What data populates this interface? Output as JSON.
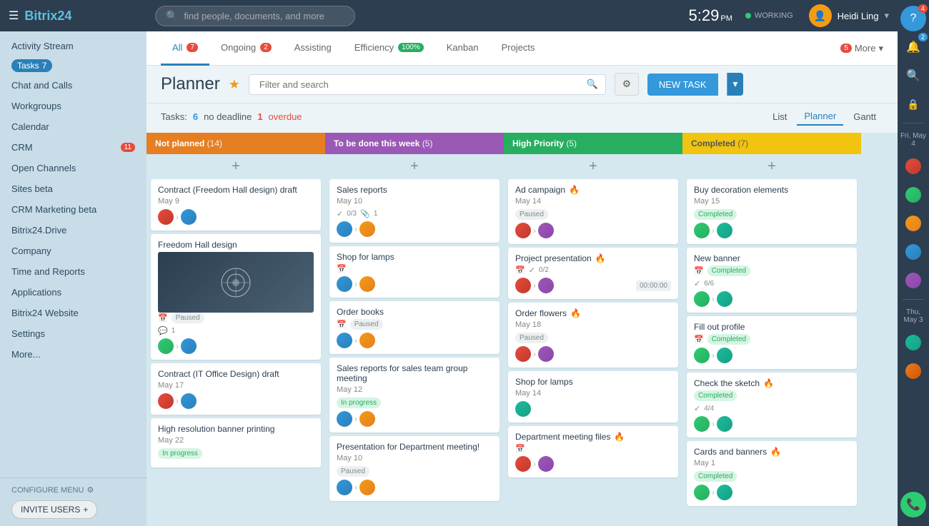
{
  "sidebar": {
    "brand": "Bitrix",
    "brand_num": "24",
    "items": [
      {
        "label": "Activity Stream",
        "badge": null
      },
      {
        "label": "Tasks",
        "badge": "7",
        "badge_type": "blue"
      },
      {
        "label": "Chat and Calls",
        "badge": null
      },
      {
        "label": "Workgroups",
        "badge": null
      },
      {
        "label": "Calendar",
        "badge": null
      },
      {
        "label": "CRM",
        "badge": "11"
      },
      {
        "label": "Open Channels",
        "badge": null
      },
      {
        "label": "Sites beta",
        "badge": null
      },
      {
        "label": "CRM Marketing beta",
        "badge": null
      },
      {
        "label": "Bitrix24.Drive",
        "badge": null
      },
      {
        "label": "Company",
        "badge": null
      },
      {
        "label": "Time and Reports",
        "badge": null
      },
      {
        "label": "Applications",
        "badge": null
      },
      {
        "label": "Bitrix24 Website",
        "badge": null
      },
      {
        "label": "Settings",
        "badge": null
      },
      {
        "label": "More...",
        "badge": null
      }
    ],
    "configure_menu": "CONFIGURE MENU",
    "invite_users": "INVITE USERS"
  },
  "topbar": {
    "search_placeholder": "find people, documents, and more",
    "time": "5:29",
    "ampm": "PM",
    "working": "WORKING",
    "user_name": "Heidi Ling",
    "help_badge": "4"
  },
  "tabs": {
    "items": [
      {
        "label": "All",
        "badge": "7",
        "active": true
      },
      {
        "label": "Ongoing",
        "badge": "2"
      },
      {
        "label": "Assisting",
        "badge": null
      },
      {
        "label": "Efficiency",
        "badge": "100%",
        "badge_type": "green"
      },
      {
        "label": "Kanban",
        "badge": null
      },
      {
        "label": "Projects",
        "badge": null
      }
    ],
    "more_label": "More",
    "more_badge": "5"
  },
  "planner": {
    "title": "Planner",
    "filter_placeholder": "Filter and search",
    "new_task": "NEW TASK",
    "tasks_count": "6",
    "no_deadline": "no deadline",
    "overdue_count": "1",
    "overdue": "overdue",
    "views": [
      "List",
      "Planner",
      "Gantt"
    ],
    "active_view": "Planner"
  },
  "columns": [
    {
      "id": "not_planned",
      "title": "Not planned",
      "count": "14",
      "color": "orange",
      "cards": [
        {
          "id": "c1",
          "title": "Contract (Freedom Hall design) draft",
          "date": "May 9",
          "avatars": [
            "av1",
            "av2"
          ],
          "badge": null,
          "has_arrow": true
        },
        {
          "id": "c2",
          "title": "Freedom Hall design",
          "date": "",
          "has_image": true,
          "badge": "Paused",
          "badge_type": "paused",
          "sub_count": "1",
          "avatars": [
            "av3",
            "av2"
          ],
          "has_arrow": true
        },
        {
          "id": "c3",
          "title": "Contract (IT Office Design) draft",
          "date": "May 17",
          "avatars": [
            "av1",
            "av2"
          ],
          "has_arrow": true
        },
        {
          "id": "c4",
          "title": "High resolution banner printing",
          "date": "May 22",
          "badge": "In progress",
          "badge_type": "inprogress"
        }
      ]
    },
    {
      "id": "to_be_done",
      "title": "To be done this week",
      "count": "5",
      "color": "purple",
      "cards": [
        {
          "id": "c5",
          "title": "Sales reports",
          "date": "May 10",
          "progress_check": "0/3",
          "progress_attach": "1",
          "avatars": [
            "av2",
            "av4"
          ],
          "has_arrow": true
        },
        {
          "id": "c6",
          "title": "Shop for lamps",
          "date": "",
          "avatars": [
            "av2",
            "av4"
          ],
          "has_arrow": true
        },
        {
          "id": "c7",
          "title": "Order books",
          "date": "",
          "badge": "Paused",
          "badge_type": "paused",
          "avatars": [
            "av2",
            "av4"
          ],
          "has_arrow": true
        },
        {
          "id": "c8",
          "title": "Sales reports for sales team group meeting",
          "date": "May 12",
          "badge": "In progress",
          "badge_type": "inprogress",
          "avatars": [
            "av2",
            "av4"
          ],
          "has_arrow": true
        },
        {
          "id": "c9",
          "title": "Presentation for Department meeting!",
          "date": "May 10",
          "badge": "Paused",
          "badge_type": "paused",
          "avatars": [
            "av2",
            "av4"
          ],
          "has_arrow": true
        }
      ]
    },
    {
      "id": "high_priority",
      "title": "High Priority",
      "count": "5",
      "color": "green",
      "cards": [
        {
          "id": "c10",
          "title": "Ad campaign",
          "fire": true,
          "date": "May 14",
          "badge": "Paused",
          "badge_type": "paused",
          "avatars": [
            "av1",
            "av5"
          ],
          "has_arrow": true
        },
        {
          "id": "c11",
          "title": "Project presentation",
          "fire": true,
          "date": "",
          "progress_check": "0/2",
          "avatars": [
            "av1",
            "av5"
          ],
          "time": "00:00:00",
          "has_arrow": true
        },
        {
          "id": "c12",
          "title": "Order flowers",
          "fire": true,
          "date": "May 18",
          "badge": "Paused",
          "badge_type": "paused",
          "avatars": [
            "av1",
            "av5"
          ],
          "has_arrow": true
        },
        {
          "id": "c13",
          "title": "Shop for lamps",
          "date": "May 14",
          "avatars": [
            "av6"
          ],
          "has_arrow": false
        },
        {
          "id": "c14",
          "title": "Department meeting files",
          "fire": true,
          "date": "",
          "avatars": [
            "av1",
            "av5"
          ],
          "has_arrow": true
        }
      ]
    },
    {
      "id": "completed",
      "title": "Completed",
      "count": "7",
      "color": "yellow",
      "cards": [
        {
          "id": "c15",
          "title": "Buy decoration elements",
          "date": "May 15",
          "badge": "Completed",
          "badge_type": "completed",
          "avatars": [
            "av3",
            "av6"
          ],
          "has_arrow": true
        },
        {
          "id": "c16",
          "title": "New banner",
          "date": "",
          "badge": "Completed",
          "badge_type": "completed",
          "progress_check": "6/6",
          "avatars": [
            "av3",
            "av6"
          ],
          "has_arrow": true
        },
        {
          "id": "c17",
          "title": "Fill out profile",
          "date": "",
          "badge": "Completed",
          "badge_type": "completed",
          "avatars": [
            "av3",
            "av6"
          ],
          "has_arrow": true
        },
        {
          "id": "c18",
          "title": "Check the sketch",
          "fire": true,
          "date": "",
          "badge": "Completed",
          "badge_type": "completed",
          "progress_check": "4/4",
          "avatars": [
            "av3",
            "av6"
          ],
          "has_arrow": true
        },
        {
          "id": "c19",
          "title": "Cards and banners",
          "fire": true,
          "date": "May 1",
          "badge": "Completed",
          "badge_type": "completed",
          "avatars": [
            "av3",
            "av6"
          ],
          "has_arrow": true
        }
      ]
    }
  ],
  "right_sidebar": {
    "notifications_badge": "2",
    "help_badge": "4",
    "date_fri": "Fri, May 4",
    "date_thu": "Thu, May 3"
  }
}
